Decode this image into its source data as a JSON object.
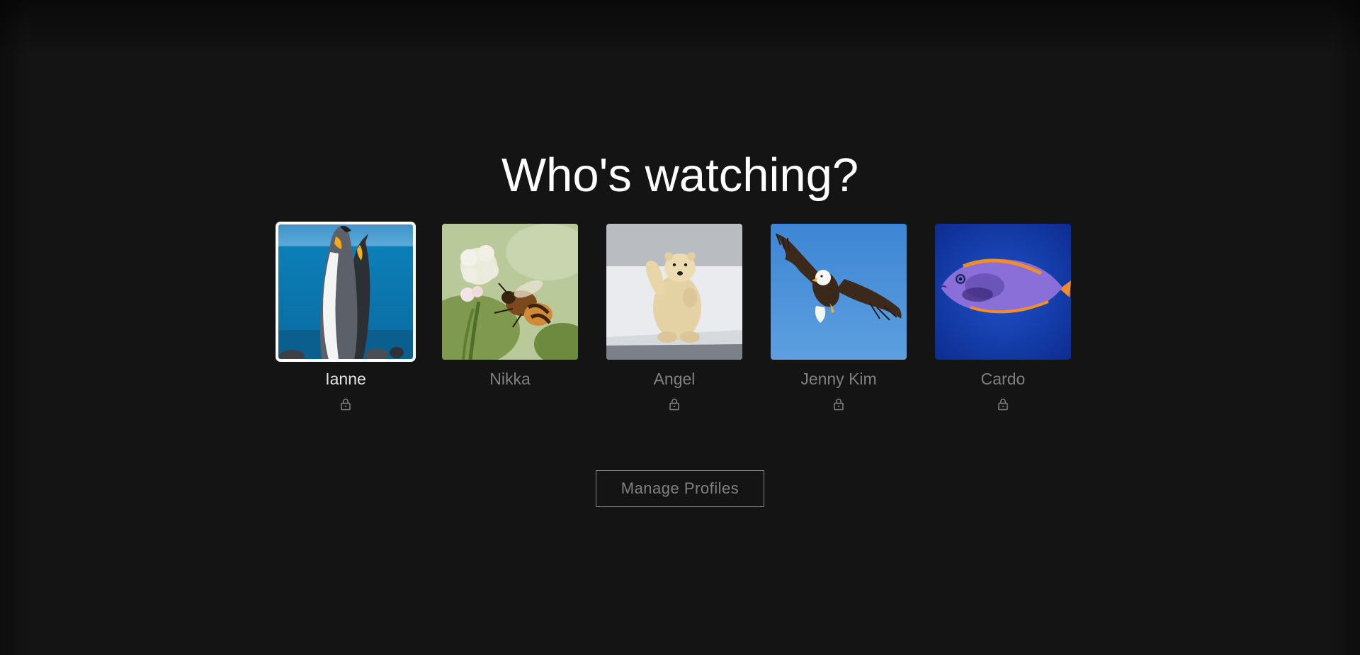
{
  "heading": "Who's watching?",
  "profiles": [
    {
      "name": "Ianne",
      "avatar_icon": "penguin-avatar",
      "locked": true,
      "selected": true
    },
    {
      "name": "Nikka",
      "avatar_icon": "bee-avatar",
      "locked": false,
      "selected": false
    },
    {
      "name": "Angel",
      "avatar_icon": "polar-bear-avatar",
      "locked": true,
      "selected": false
    },
    {
      "name": "Jenny Kim",
      "avatar_icon": "eagle-avatar",
      "locked": true,
      "selected": false
    },
    {
      "name": "Cardo",
      "avatar_icon": "fish-avatar",
      "locked": true,
      "selected": false
    }
  ],
  "manage_label": "Manage Profiles",
  "colors": {
    "background": "#141414",
    "heading": "#ffffff",
    "name_inactive": "#808080",
    "name_active": "#e5e5e5",
    "button_border": "#808080"
  }
}
